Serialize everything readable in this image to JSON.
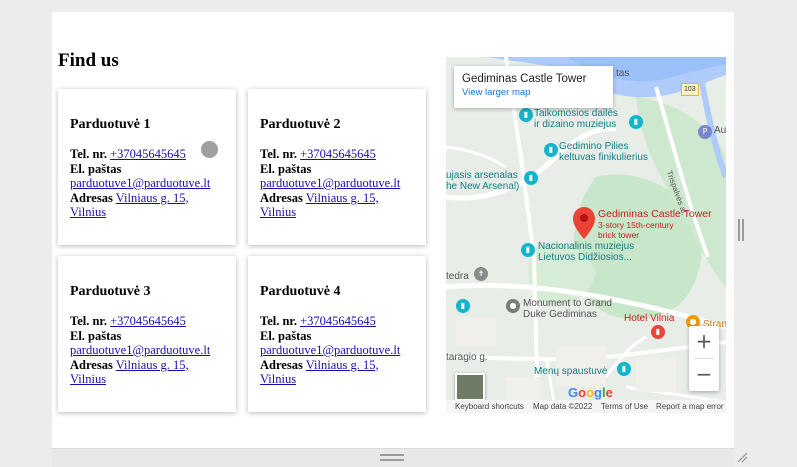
{
  "section": {
    "heading": "Find us"
  },
  "stores": [
    {
      "name": "Parduotuvė 1",
      "phone_label": "Tel. nr.",
      "phone": "+37045645645",
      "email_label": "El. paštas",
      "email": "parduotuve1@parduotuve.lt",
      "address_label": "Adresas",
      "address_line1": "Vilniaus g. 15,",
      "address_line2": "Vilnius"
    },
    {
      "name": "Parduotuvė 2",
      "phone_label": "Tel. nr.",
      "phone": "+37045645645",
      "email_label": "El. paštas",
      "email": "parduotuve1@parduotuve.lt",
      "address_label": "Adresas",
      "address_line1": "Vilniaus g. 15,",
      "address_line2": "Vilnius"
    },
    {
      "name": "Parduotuvė 3",
      "phone_label": "Tel. nr.",
      "phone": "+37045645645",
      "email_label": "El. paštas",
      "email": "parduotuve1@parduotuve.lt",
      "address_label": "Adresas",
      "address_line1": "Vilniaus g. 15,",
      "address_line2": "Vilnius"
    },
    {
      "name": "Parduotuvė 4",
      "phone_label": "Tel. nr.",
      "phone": "+37045645645",
      "email_label": "El. paštas",
      "email": "parduotuve1@parduotuve.lt",
      "address_label": "Adresas",
      "address_line1": "Vilniaus g. 15,",
      "address_line2": "Vilnius"
    }
  ],
  "map": {
    "info_title": "Gediminas Castle Tower",
    "info_link": "View larger map",
    "labels": {
      "tas": "tas",
      "route": "103",
      "museum": "Taikomosios dailės ir dizaino muziejus",
      "museum_l1": "Taikomosios dailės",
      "museum_l2": "ir dizaino muziejus",
      "funicular_l1": "Gedimino Pilies",
      "funicular_l2": "keltuvas finikulierius",
      "arsenal_l1": "ujasis arsenalas",
      "arsenal_l2": "he New Arsenal)",
      "tower_l1": "Gediminas Castle Tower",
      "tower_l2": "3-story 15th-century",
      "tower_l3": "brick tower",
      "national_l1": "Nacionalinis muziejus",
      "national_l2": "Lietuvos Didžiosios...",
      "street_a": "Trispalvės al.",
      "tedra": "tedra",
      "monument_l1": "Monument to Grand",
      "monument_l2": "Duke Gediminas",
      "hotel": "Hotel Vilnia",
      "strange": "Stran",
      "taragio": "taragio g.",
      "menu_l1": "Menų spaustuvė",
      "au": "Au"
    },
    "google": "Google",
    "footer": {
      "shortcuts": "Keyboard shortcuts",
      "data": "Map data ©2022",
      "terms": "Terms of Use",
      "report": "Report a map error"
    },
    "zoom_in": "+",
    "zoom_out": "−"
  }
}
